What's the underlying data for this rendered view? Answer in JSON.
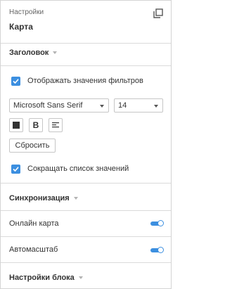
{
  "panel": {
    "subtitle": "Настройки",
    "title": "Карта",
    "popout_icon": "popout-icon"
  },
  "sections": {
    "header": {
      "label": "Заголовок"
    },
    "sync": {
      "label": "Синхронизация"
    },
    "block": {
      "label": "Настройки блока"
    }
  },
  "header_settings": {
    "show_filter_values": {
      "label": "Отображать значения фильтров",
      "checked": true
    },
    "font_family": {
      "value": "Microsoft Sans Serif"
    },
    "font_size": {
      "value": "14"
    },
    "format_buttons": {
      "color_icon": "color-square-icon",
      "bold_label": "B",
      "align_icon": "align-left-icon"
    },
    "reset_label": "Сбросить",
    "shorten_values": {
      "label": "Сокращать список значений",
      "checked": true
    }
  },
  "sync_settings": {
    "online_map": {
      "label": "Онлайн карта",
      "on": true
    },
    "autoscale": {
      "label": "Автомасштаб",
      "on": true
    }
  },
  "colors": {
    "accent": "#3c8fe0",
    "border": "#d4d4d4",
    "text": "#333333"
  }
}
